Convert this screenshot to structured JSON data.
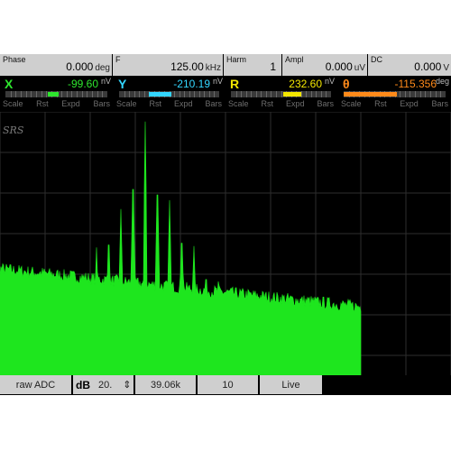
{
  "params": {
    "phase": {
      "label": "Phase",
      "value": "0.000",
      "unit": "deg"
    },
    "freq": {
      "label": "F",
      "value": "125.00",
      "unit": "kHz"
    },
    "harm": {
      "label": "Harm",
      "value": "1"
    },
    "ampl": {
      "label": "Ampl",
      "value": "0.000",
      "unit": "uV"
    },
    "dc": {
      "label": "DC",
      "value": "0.000",
      "unit": "V"
    }
  },
  "meters": [
    {
      "label": "X",
      "value": "-99.60",
      "unit": "nV",
      "color": "#2ee62e",
      "fill_start": 0.42,
      "fill_end": 0.52
    },
    {
      "label": "Y",
      "value": "-210.19",
      "unit": "nV",
      "color": "#33d6ff",
      "fill_start": 0.3,
      "fill_end": 0.52
    },
    {
      "label": "R",
      "value": "232.60",
      "unit": "nV",
      "color": "#f2e600",
      "fill_start": 0.52,
      "fill_end": 0.7
    },
    {
      "label": "θ",
      "value": "-115.356",
      "unit": "deg",
      "color": "#ff8a1a",
      "fill_start": 0.0,
      "fill_end": 0.52
    }
  ],
  "meter_buttons": [
    "Scale",
    "Rst",
    "Expd",
    "Bars"
  ],
  "logo": "SRS",
  "bottom": {
    "source": "raw ADC",
    "scale": "dB",
    "scale_value": "20.",
    "adjust": "⇕",
    "span": "39.06k",
    "average": "10",
    "mode": "Live"
  },
  "spectrum_color": "#1ee61e",
  "grid_color": "#2e2e2e"
}
